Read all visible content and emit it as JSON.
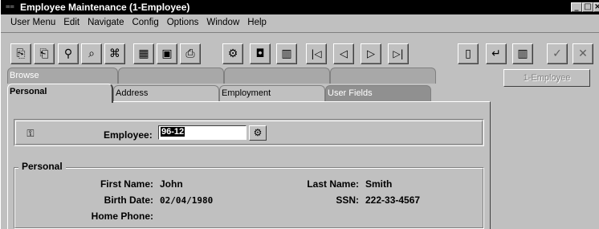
{
  "window": {
    "title": "Employee Maintenance (1-Employee)",
    "controls": [
      "_",
      "□",
      "×"
    ]
  },
  "menu": [
    "User Menu",
    "Edit",
    "Navigate",
    "Config",
    "Options",
    "Window",
    "Help"
  ],
  "toolbar": {
    "icons": [
      "copy-icon",
      "paste-icon",
      "filter-icon",
      "query-icon",
      "query2-icon",
      "calculator-icon",
      "calendar-icon",
      "print-icon",
      "find-icon",
      "camera-icon",
      "chart-icon",
      "first-record-icon",
      "previous-record-icon",
      "next-record-icon",
      "last-record-icon",
      "new-record-icon",
      "undo-icon",
      "delete-icon",
      "save-icon",
      "cancel-icon"
    ]
  },
  "tabs": {
    "row1": [
      "Browse",
      "",
      "",
      ""
    ],
    "row2": [
      "Personal",
      "Address",
      "Employment",
      "User Fields"
    ]
  },
  "side_button": "1-Employee",
  "employee": {
    "label": "Employee:",
    "value": "96-12"
  },
  "personal": {
    "group_label": "Personal",
    "first_name_label": "First Name:",
    "first_name": "John",
    "last_name_label": "Last Name:",
    "last_name": "Smith",
    "birth_date_label": "Birth Date:",
    "birth_date": "02/04/1980",
    "ssn_label": "SSN:",
    "ssn": "222-33-4567",
    "home_phone_label": "Home Phone:",
    "home_phone": ""
  }
}
